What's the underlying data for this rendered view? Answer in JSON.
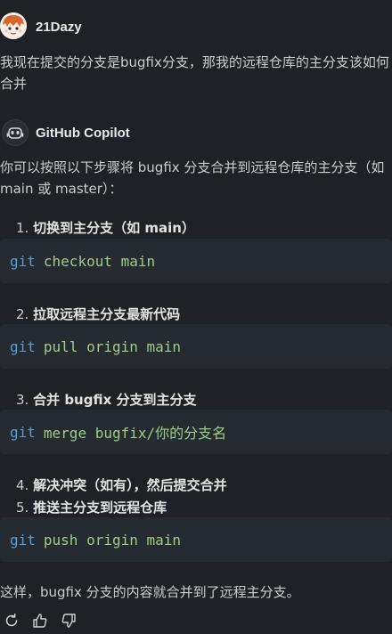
{
  "user": {
    "name": "21Dazy",
    "question": "我现在提交的分支是bugfix分支，那我的远程仓库的主分支该如何合并"
  },
  "assistant": {
    "name": "GitHub Copilot",
    "intro": "你可以按照以下步骤将 bugfix 分支合并到远程仓库的主分支（如 main 或 master）：",
    "steps": [
      {
        "num": "1.",
        "text": "切换到主分支（如 main）"
      },
      {
        "num": "2.",
        "text": "拉取远程主分支最新代码"
      },
      {
        "num": "3.",
        "text": "合并 bugfix 分支到主分支"
      },
      {
        "num": "4.",
        "text": "解决冲突（如有），然后提交合并"
      },
      {
        "num": "5.",
        "text": "推送主分支到远程仓库"
      }
    ],
    "code": [
      {
        "cmd": "git",
        "args": "checkout main"
      },
      {
        "cmd": "git",
        "args": "pull origin main"
      },
      {
        "cmd": "git",
        "args": "merge bugfix/你的分支名"
      },
      {
        "cmd": "git",
        "args": "push origin main"
      }
    ],
    "outro": "这样，bugfix 分支的内容就合并到了远程主分支。"
  },
  "actions": {
    "icons": [
      "retry-icon",
      "thumbs-up-icon",
      "thumbs-down-icon"
    ]
  },
  "colors": {
    "background": "#1f2126",
    "code_background": "#262a31",
    "keyword": "#569cd6",
    "argument": "#9bce86"
  }
}
